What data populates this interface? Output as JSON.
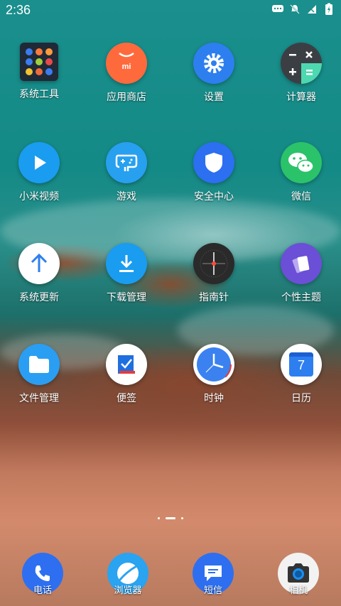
{
  "status": {
    "time": "2:36"
  },
  "grid": {
    "row1": [
      {
        "label": "系统工具"
      },
      {
        "label": "应用商店"
      },
      {
        "label": "设置"
      },
      {
        "label": "计算器"
      }
    ],
    "row2": [
      {
        "label": "小米视频"
      },
      {
        "label": "游戏"
      },
      {
        "label": "安全中心"
      },
      {
        "label": "微信"
      }
    ],
    "row3": [
      {
        "label": "系统更新"
      },
      {
        "label": "下载管理"
      },
      {
        "label": "指南针"
      },
      {
        "label": "个性主题"
      }
    ],
    "row4": [
      {
        "label": "文件管理"
      },
      {
        "label": "便签"
      },
      {
        "label": "时钟"
      },
      {
        "label": "日历",
        "day": "7"
      }
    ]
  },
  "dock": [
    {
      "label": "电话"
    },
    {
      "label": "浏览器"
    },
    {
      "label": "短信"
    },
    {
      "label": "相机"
    }
  ],
  "app_store_logo": "mi",
  "colors": {
    "app_store": "#ff6a3d",
    "settings": "#2d7ff0",
    "video": "#1a9cf0",
    "security": "#2c6ff0",
    "wechat": "#2ac36a",
    "theme": "#6b4fd6",
    "files": "#2a9ef3",
    "phone": "#2d6ff0"
  }
}
